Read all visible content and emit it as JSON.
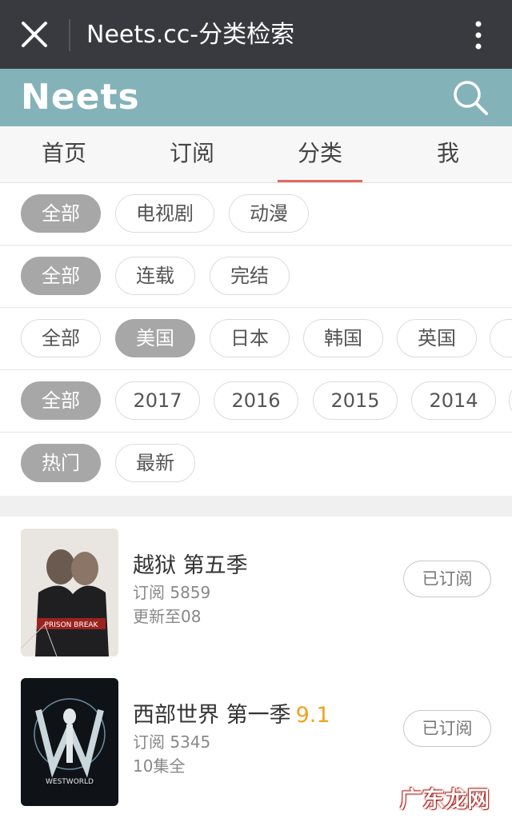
{
  "window": {
    "title": "Neets.cc-分类检索"
  },
  "brand": {
    "logo": "Neets"
  },
  "tabs": [
    {
      "label": "首页",
      "active": false
    },
    {
      "label": "订阅",
      "active": false
    },
    {
      "label": "分类",
      "active": true
    },
    {
      "label": "我",
      "active": false
    }
  ],
  "filters": {
    "type": {
      "options": [
        "全部",
        "电视剧",
        "动漫"
      ],
      "selected": "全部"
    },
    "status": {
      "options": [
        "全部",
        "连载",
        "完结"
      ],
      "selected": "全部"
    },
    "region": {
      "options": [
        "全部",
        "美国",
        "日本",
        "韩国",
        "英国"
      ],
      "selected": "美国"
    },
    "year": {
      "options": [
        "全部",
        "2017",
        "2016",
        "2015",
        "2014"
      ],
      "selected": "全部"
    },
    "sort": {
      "options": [
        "热门",
        "最新"
      ],
      "selected": "热门"
    }
  },
  "shows": [
    {
      "title": "越狱 第五季",
      "score": "",
      "subscribers": "订阅 5859",
      "progress": "更新至08",
      "button": "已订阅",
      "poster_text": "PRISON BREAK"
    },
    {
      "title": "西部世界 第一季",
      "score": "9.1",
      "subscribers": "订阅 5345",
      "progress": "10集全",
      "button": "已订阅",
      "poster_text": "WESTWORLD"
    }
  ],
  "watermark": "广东龙网",
  "colors": {
    "titlebar": "#393a3f",
    "brandbar": "#84b2b9",
    "tab_indicator": "#e26a5e",
    "chip_selected": "#a7a7a7",
    "score": "#f0a21d"
  }
}
